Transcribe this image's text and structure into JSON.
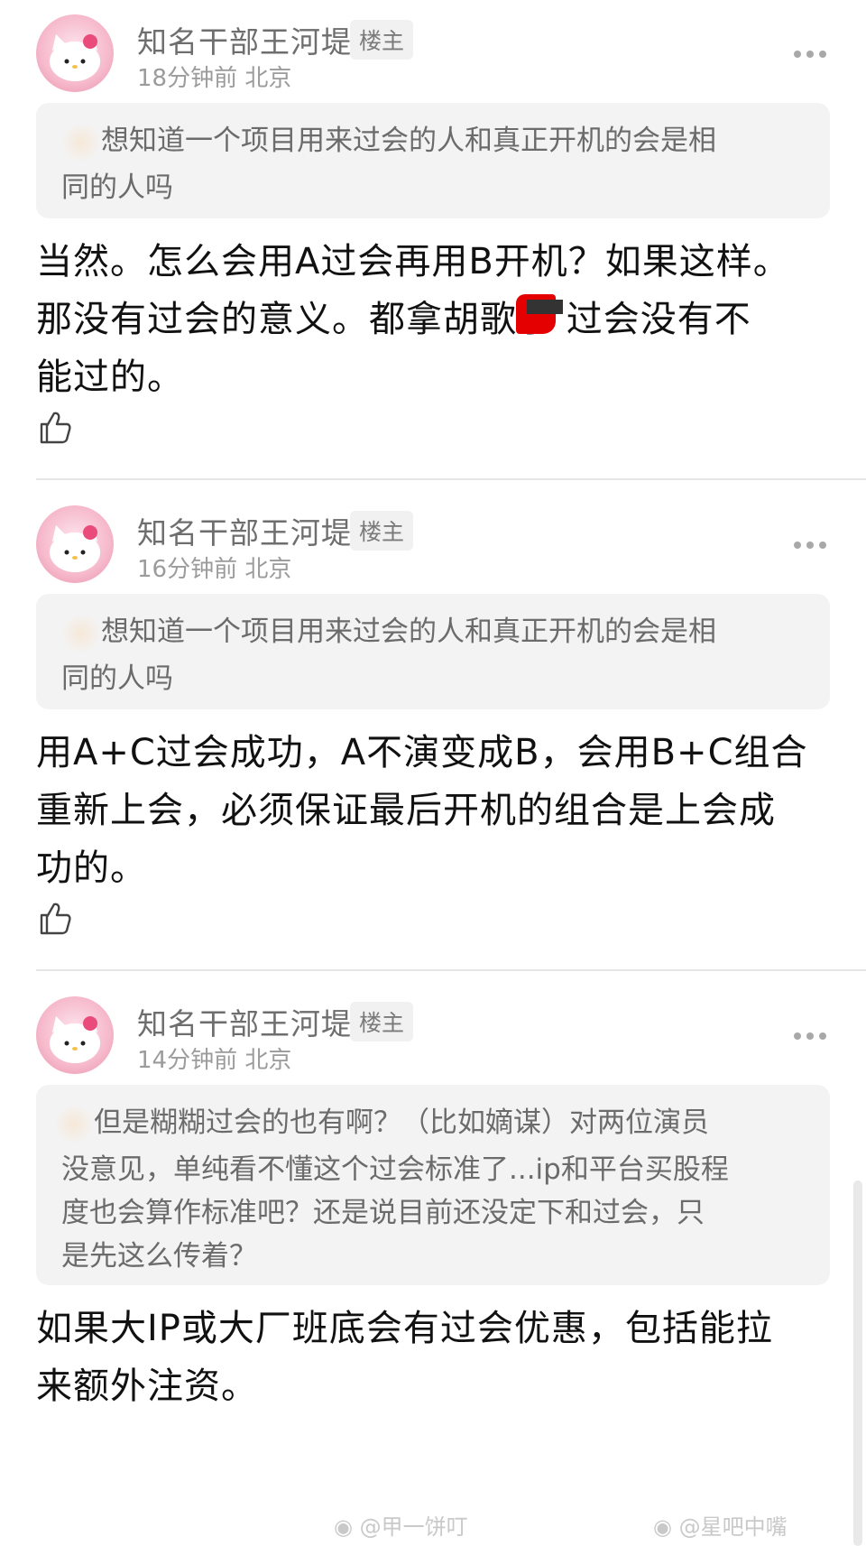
{
  "posts": [
    {
      "username": "知名干部王河堤",
      "badge": "楼主",
      "time": "18分钟前",
      "location": "北京",
      "quote_lines": [
        "想知道一个项目用来过会的人和真正开机的会是相",
        "同的人吗"
      ],
      "body_lines": [
        "当然。怎么会用A过会再用B开机？如果这样。",
        "那没有过会的意义。都拿胡歌了    过会没有不",
        "能过的。"
      ]
    },
    {
      "username": "知名干部王河堤",
      "badge": "楼主",
      "time": "16分钟前",
      "location": "北京",
      "quote_lines": [
        "想知道一个项目用来过会的人和真正开机的会是相",
        "同的人吗"
      ],
      "body_lines": [
        "用A+C过会成功，A不演变成B，会用B+C组合",
        "重新上会，必须保证最后开机的组合是上会成",
        "功的。"
      ]
    },
    {
      "username": "知名干部王河堤",
      "badge": "楼主",
      "time": "14分钟前",
      "location": "北京",
      "quote_lines": [
        "但是糊糊过会的也有啊？（比如嫡谋）对两位演员",
        "没意见，单纯看不懂这个过会标准了...ip和平台买股程",
        "度也会算作标准吧？还是说目前还没定下和过会，只",
        "是先这么传着？"
      ],
      "body_lines": [
        "如果大IP或大厂班底会有过会优惠，包括能拉",
        "来额外注资。"
      ]
    }
  ],
  "watermarks": [
    "@甲一饼叮",
    "@星吧中嘴"
  ],
  "icons": {
    "more": "more-dots-icon",
    "like": "thumbs-up-icon",
    "weibo": "weibo-logo-icon"
  }
}
